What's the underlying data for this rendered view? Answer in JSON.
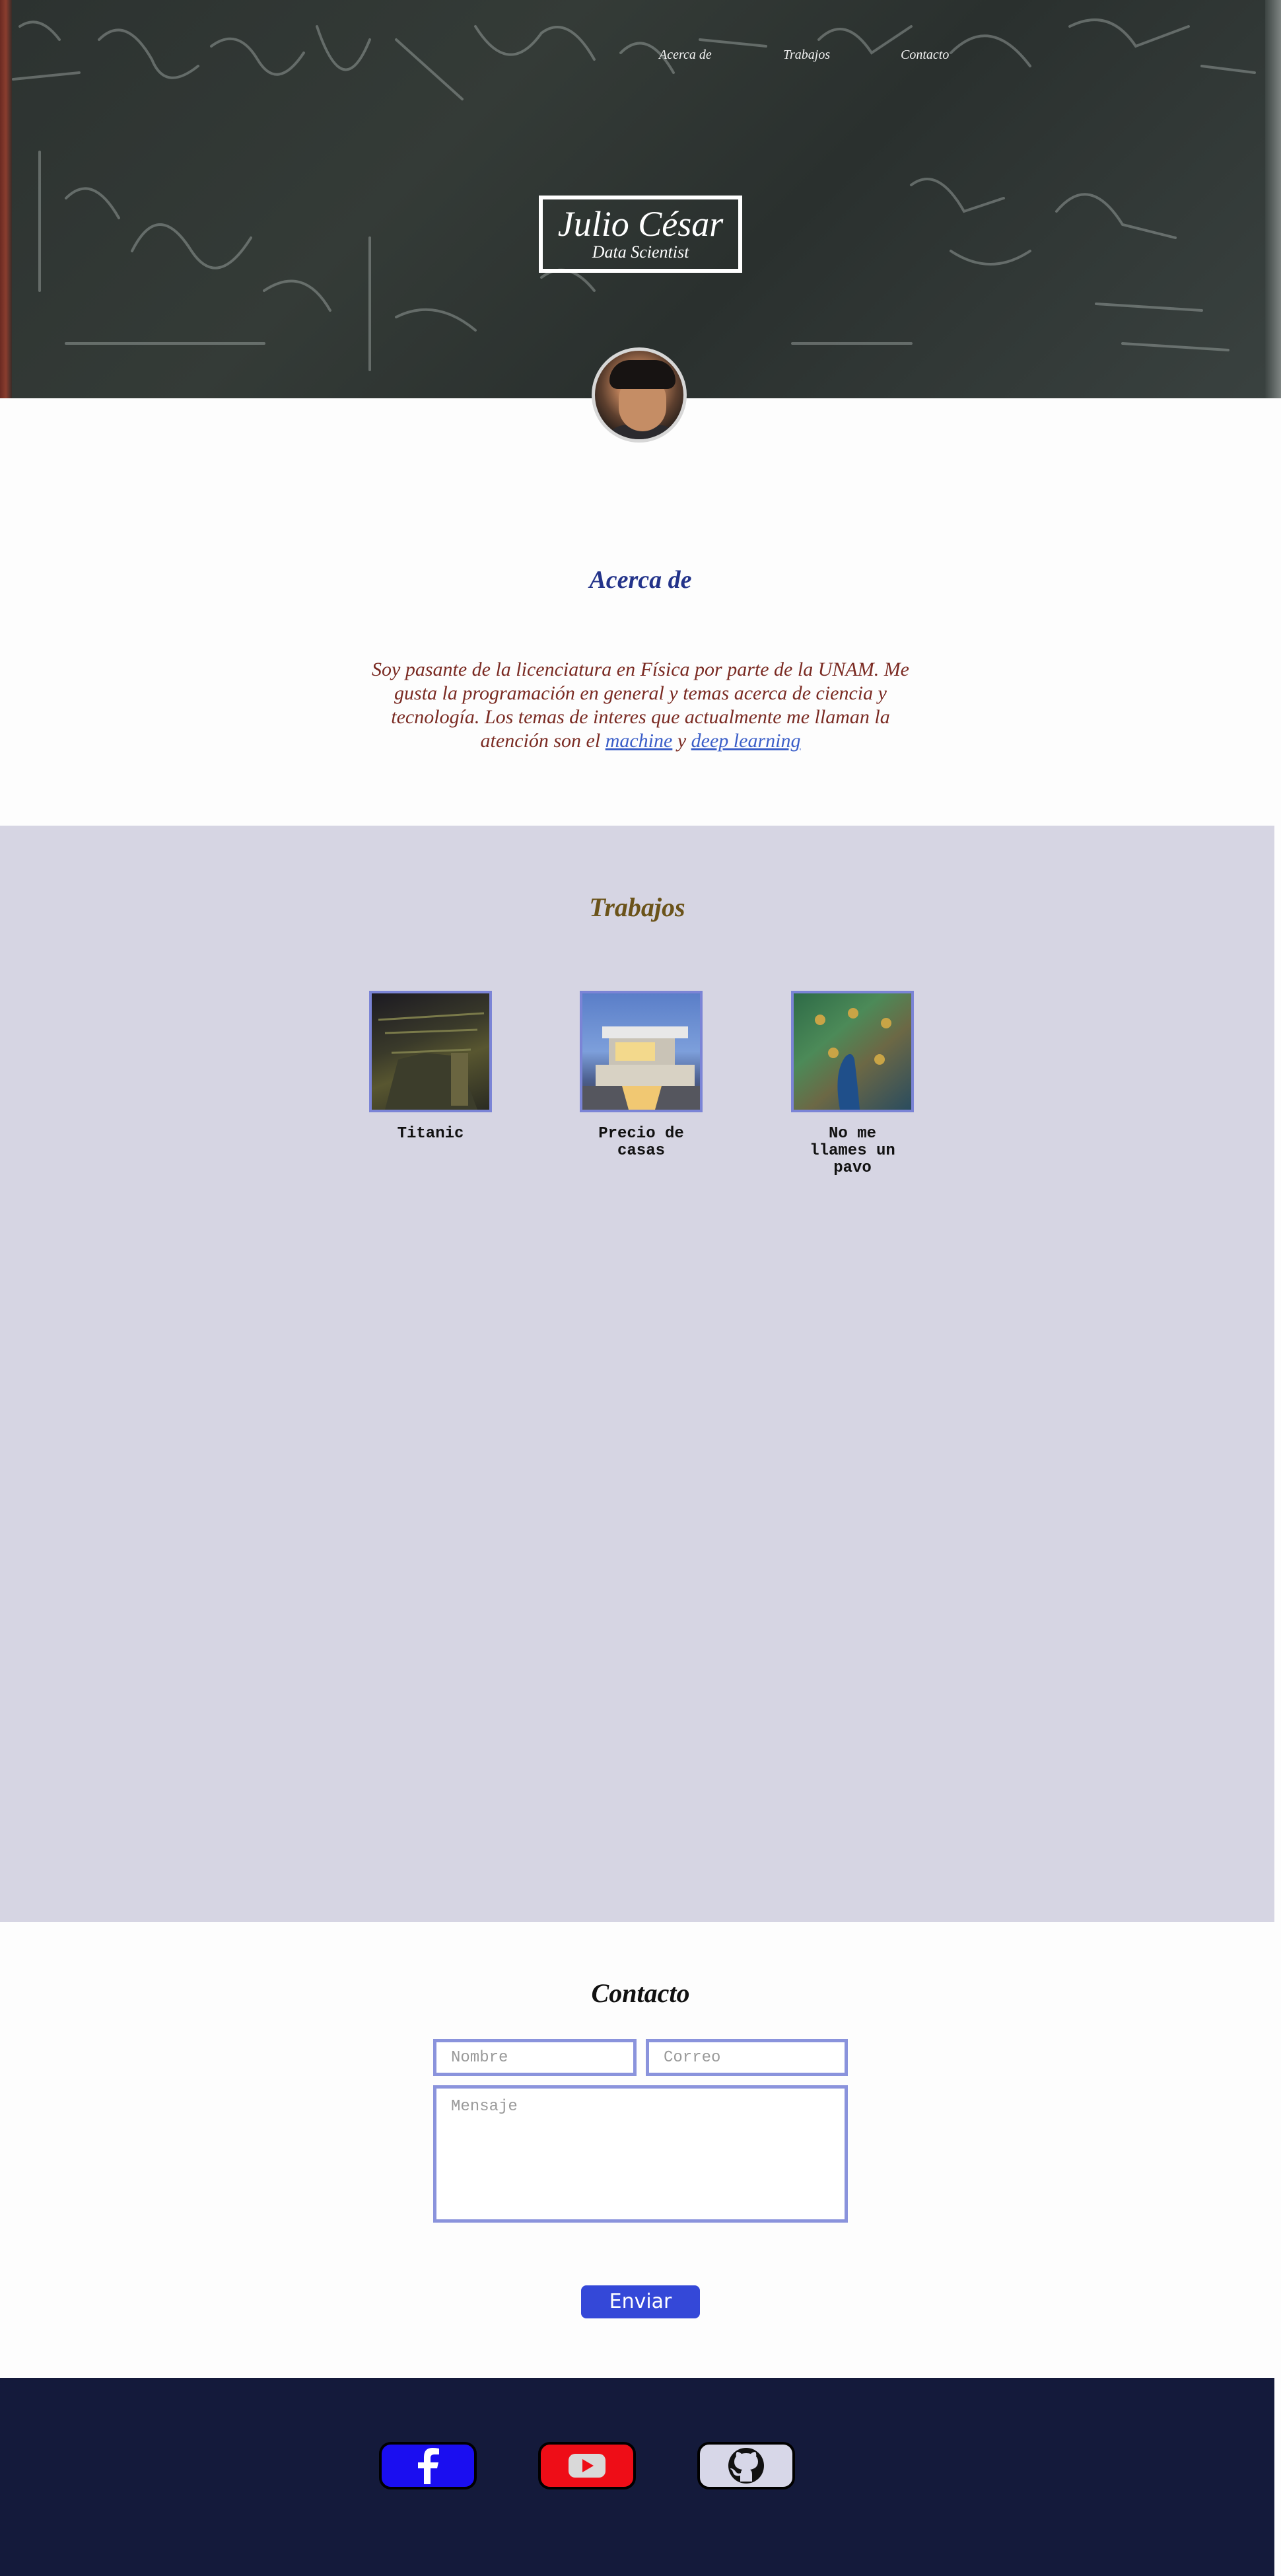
{
  "nav": {
    "links": [
      "Acerca de",
      "Trabajos",
      "Contacto"
    ]
  },
  "hero": {
    "name": "Julio César",
    "role": "Data Scientist"
  },
  "about": {
    "title": "Acerca de",
    "text": "Soy pasante de la licenciatura en Física por parte de la UNAM. Me gusta la programación en general y temas acerca de ciencia y tecnología. Los temas de interes que actualmente me llaman la atención son el ",
    "link1": "machine",
    "connector": " y ",
    "link2": "deep learning"
  },
  "works": {
    "title": "Trabajos",
    "items": [
      {
        "label": "Titanic"
      },
      {
        "label": "Precio de casas"
      },
      {
        "label": "No me llames un pavo"
      }
    ]
  },
  "contact": {
    "title": "Contacto",
    "name_placeholder": "Nombre",
    "email_placeholder": "Correo",
    "message_placeholder": "Mensaje",
    "send_label": "Enviar"
  },
  "colors": {
    "accent_blue": "#3448d8",
    "works_bg": "#d6d5e3",
    "footer_bg": "#141a3b",
    "facebook": "#1a0ef0",
    "youtube": "#ee0d17",
    "github": "#d7d7e8"
  },
  "footer": {
    "social": [
      "facebook-icon",
      "youtube-icon",
      "github-icon"
    ]
  }
}
